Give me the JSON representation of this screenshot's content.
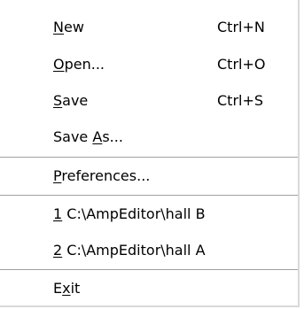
{
  "menu": {
    "items": [
      {
        "mnemonic": "N",
        "rest": "ew",
        "shortcut": "Ctrl+N"
      },
      {
        "mnemonic": "O",
        "rest": "pen...",
        "shortcut": "Ctrl+O"
      },
      {
        "mnemonic": "S",
        "rest": "ave",
        "shortcut": "Ctrl+S"
      },
      {
        "prefix": "Save ",
        "mnemonic": "A",
        "rest": "s...",
        "shortcut": ""
      },
      {
        "mnemonic": "P",
        "rest": "references...",
        "shortcut": ""
      },
      {
        "mnemonic": "1",
        "rest": " C:\\AmpEditor\\hall B",
        "shortcut": ""
      },
      {
        "mnemonic": "2",
        "rest": " C:\\AmpEditor\\hall A",
        "shortcut": ""
      },
      {
        "prefix": "E",
        "mnemonic": "x",
        "rest": "it",
        "shortcut": ""
      }
    ]
  }
}
